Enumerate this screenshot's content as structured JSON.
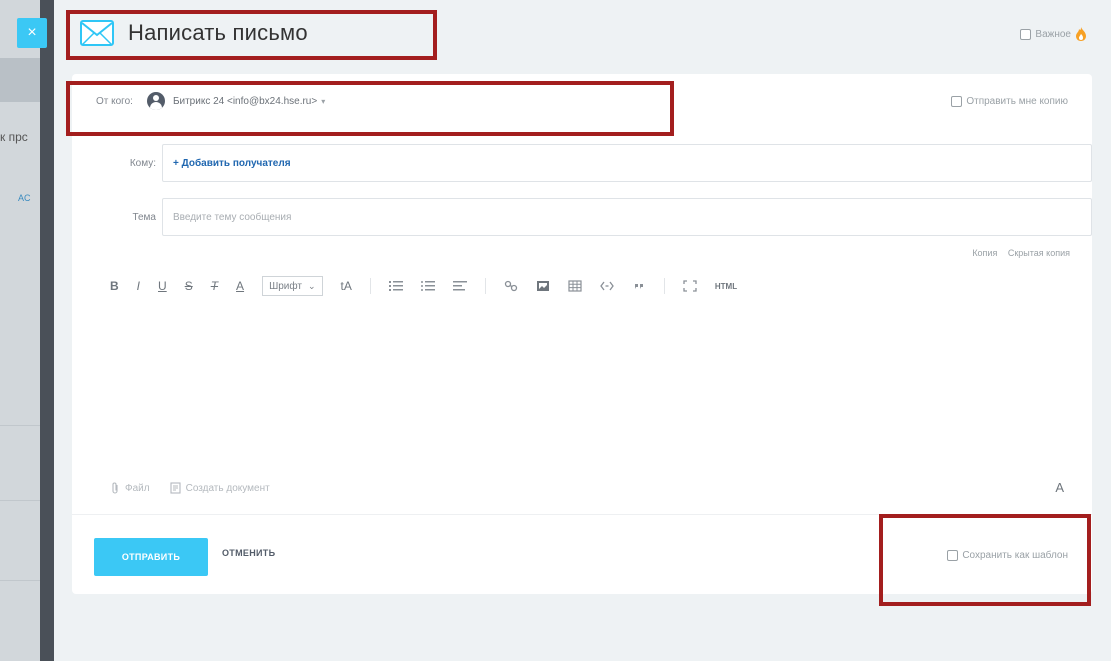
{
  "window": {
    "close_symbol": "×",
    "title": "Написать письмо",
    "important_label": "Важное"
  },
  "background": {
    "partial_text": "к прс",
    "partial_link": "AC"
  },
  "from": {
    "label": "От кого:",
    "value": "Битрикс 24 <info@bx24.hse.ru>",
    "send_copy_label": "Отправить мне копию"
  },
  "to": {
    "label": "Кому:",
    "add_recipient": "+ Добавить получателя"
  },
  "subject": {
    "label": "Тема",
    "placeholder": "Введите тему сообщения"
  },
  "copy_links": {
    "copy": "Копия",
    "hidden_copy": "Скрытая копия"
  },
  "toolbar": {
    "bold": "B",
    "italic": "I",
    "underline": "U",
    "strike": "S",
    "clear_format": "T",
    "font_color": "A",
    "font_select": "Шрифт",
    "font_size": "tA",
    "html": "HTML"
  },
  "attachments": {
    "file": "Файл",
    "create_doc": "Создать документ",
    "format_toggle": "A"
  },
  "actions": {
    "send": "ОТПРАВИТЬ",
    "cancel": "ОТМЕНИТЬ",
    "save_template": "Сохранить как шаблон"
  },
  "colors": {
    "accent": "#3bc8f5",
    "link": "#2067b0",
    "annotation": "#a31e1e"
  },
  "icons": [
    "close-icon",
    "mail-icon",
    "fire-icon",
    "avatar-icon",
    "link-icon",
    "image-icon",
    "table-icon",
    "code-icon",
    "quote-icon",
    "fullscreen-icon",
    "paperclip-icon",
    "document-icon"
  ]
}
